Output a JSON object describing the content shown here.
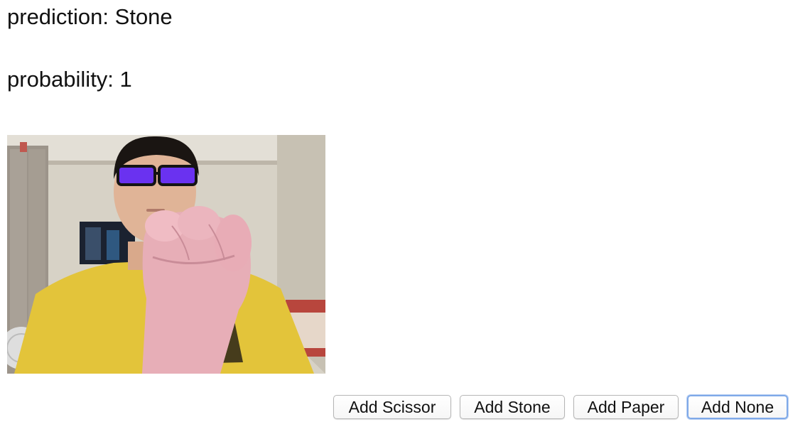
{
  "status": {
    "prediction_label": "prediction:",
    "prediction_value": "Stone",
    "probability_label": "probability:",
    "probability_value": "1"
  },
  "webcam": {
    "description": ""
  },
  "buttons": {
    "add_scissor": "Add Scissor",
    "add_stone": "Add Stone",
    "add_paper": "Add Paper",
    "add_none": "Add None"
  },
  "colors": {
    "background": "#ffffff",
    "text": "#111111",
    "button_border": "#b5b5b5",
    "focus_ring": "#7fa9e8",
    "shirt": "#e3c43a",
    "glasses_tint": "#6a32f0"
  }
}
